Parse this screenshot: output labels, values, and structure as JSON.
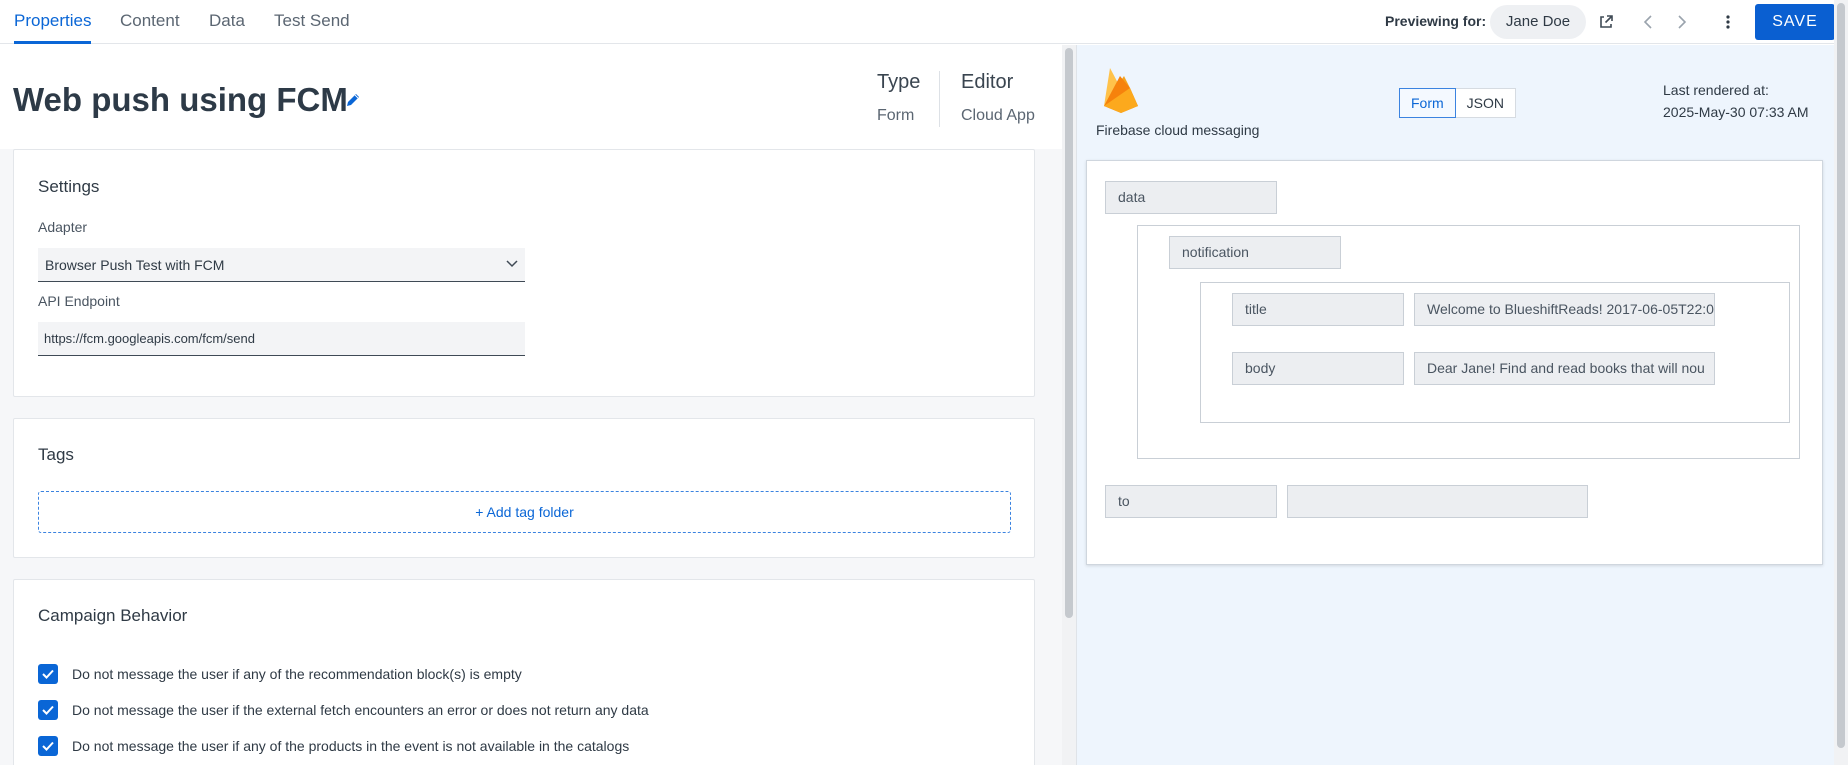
{
  "tabs": [
    {
      "label": "Properties",
      "active": true
    },
    {
      "label": "Content",
      "active": false
    },
    {
      "label": "Data",
      "active": false
    },
    {
      "label": "Test Send",
      "active": false
    }
  ],
  "header": {
    "previewing_label": "Previewing for:",
    "preview_user": "Jane Doe",
    "save_label": "SAVE"
  },
  "template": {
    "title": "Web push using FCM",
    "type_label": "Type",
    "type_value": "Form",
    "editor_label": "Editor",
    "editor_value": "Cloud App"
  },
  "settings": {
    "title": "Settings",
    "adapter_label": "Adapter",
    "adapter_value": "Browser Push Test with FCM",
    "endpoint_label": "API Endpoint",
    "endpoint_value": "https://fcm.googleapis.com/fcm/send"
  },
  "tags": {
    "title": "Tags",
    "add_folder_label": "+ Add tag folder"
  },
  "campaign_behavior": {
    "title": "Campaign Behavior",
    "options": [
      {
        "label": "Do not message the user if any of the recommendation block(s) is empty",
        "checked": true
      },
      {
        "label": "Do not message the user if the external fetch encounters an error or does not return any data",
        "checked": true
      },
      {
        "label": "Do not message the user if any of the products in the event is not available in the catalogs",
        "checked": true
      }
    ]
  },
  "preview": {
    "provider_name": "Firebase cloud messaging",
    "view_modes": [
      "Form",
      "JSON"
    ],
    "active_mode": "Form",
    "last_rendered_label": "Last rendered at:",
    "last_rendered_value": "2025-May-30 07:33 AM",
    "payload": {
      "data_key": "data",
      "notification_key": "notification",
      "title_key": "title",
      "title_value": "Welcome to BlueshiftReads! 2017-06-05T22:0",
      "body_key": "body",
      "body_value": "Dear Jane! Find and read books that will nou",
      "to_key": "to",
      "to_value": ""
    }
  },
  "colors": {
    "accent": "#0a66d6",
    "save_button": "#0a5fd1",
    "preview_background": "#eef5fd",
    "firebase_orange": "#f5a623"
  },
  "icons": [
    "edit-pencil-icon",
    "external-link-icon",
    "chevron-left-icon",
    "chevron-right-icon",
    "more-vertical-icon",
    "chevron-down-icon",
    "checkbox-checked-icon",
    "firebase-logo-icon"
  ]
}
